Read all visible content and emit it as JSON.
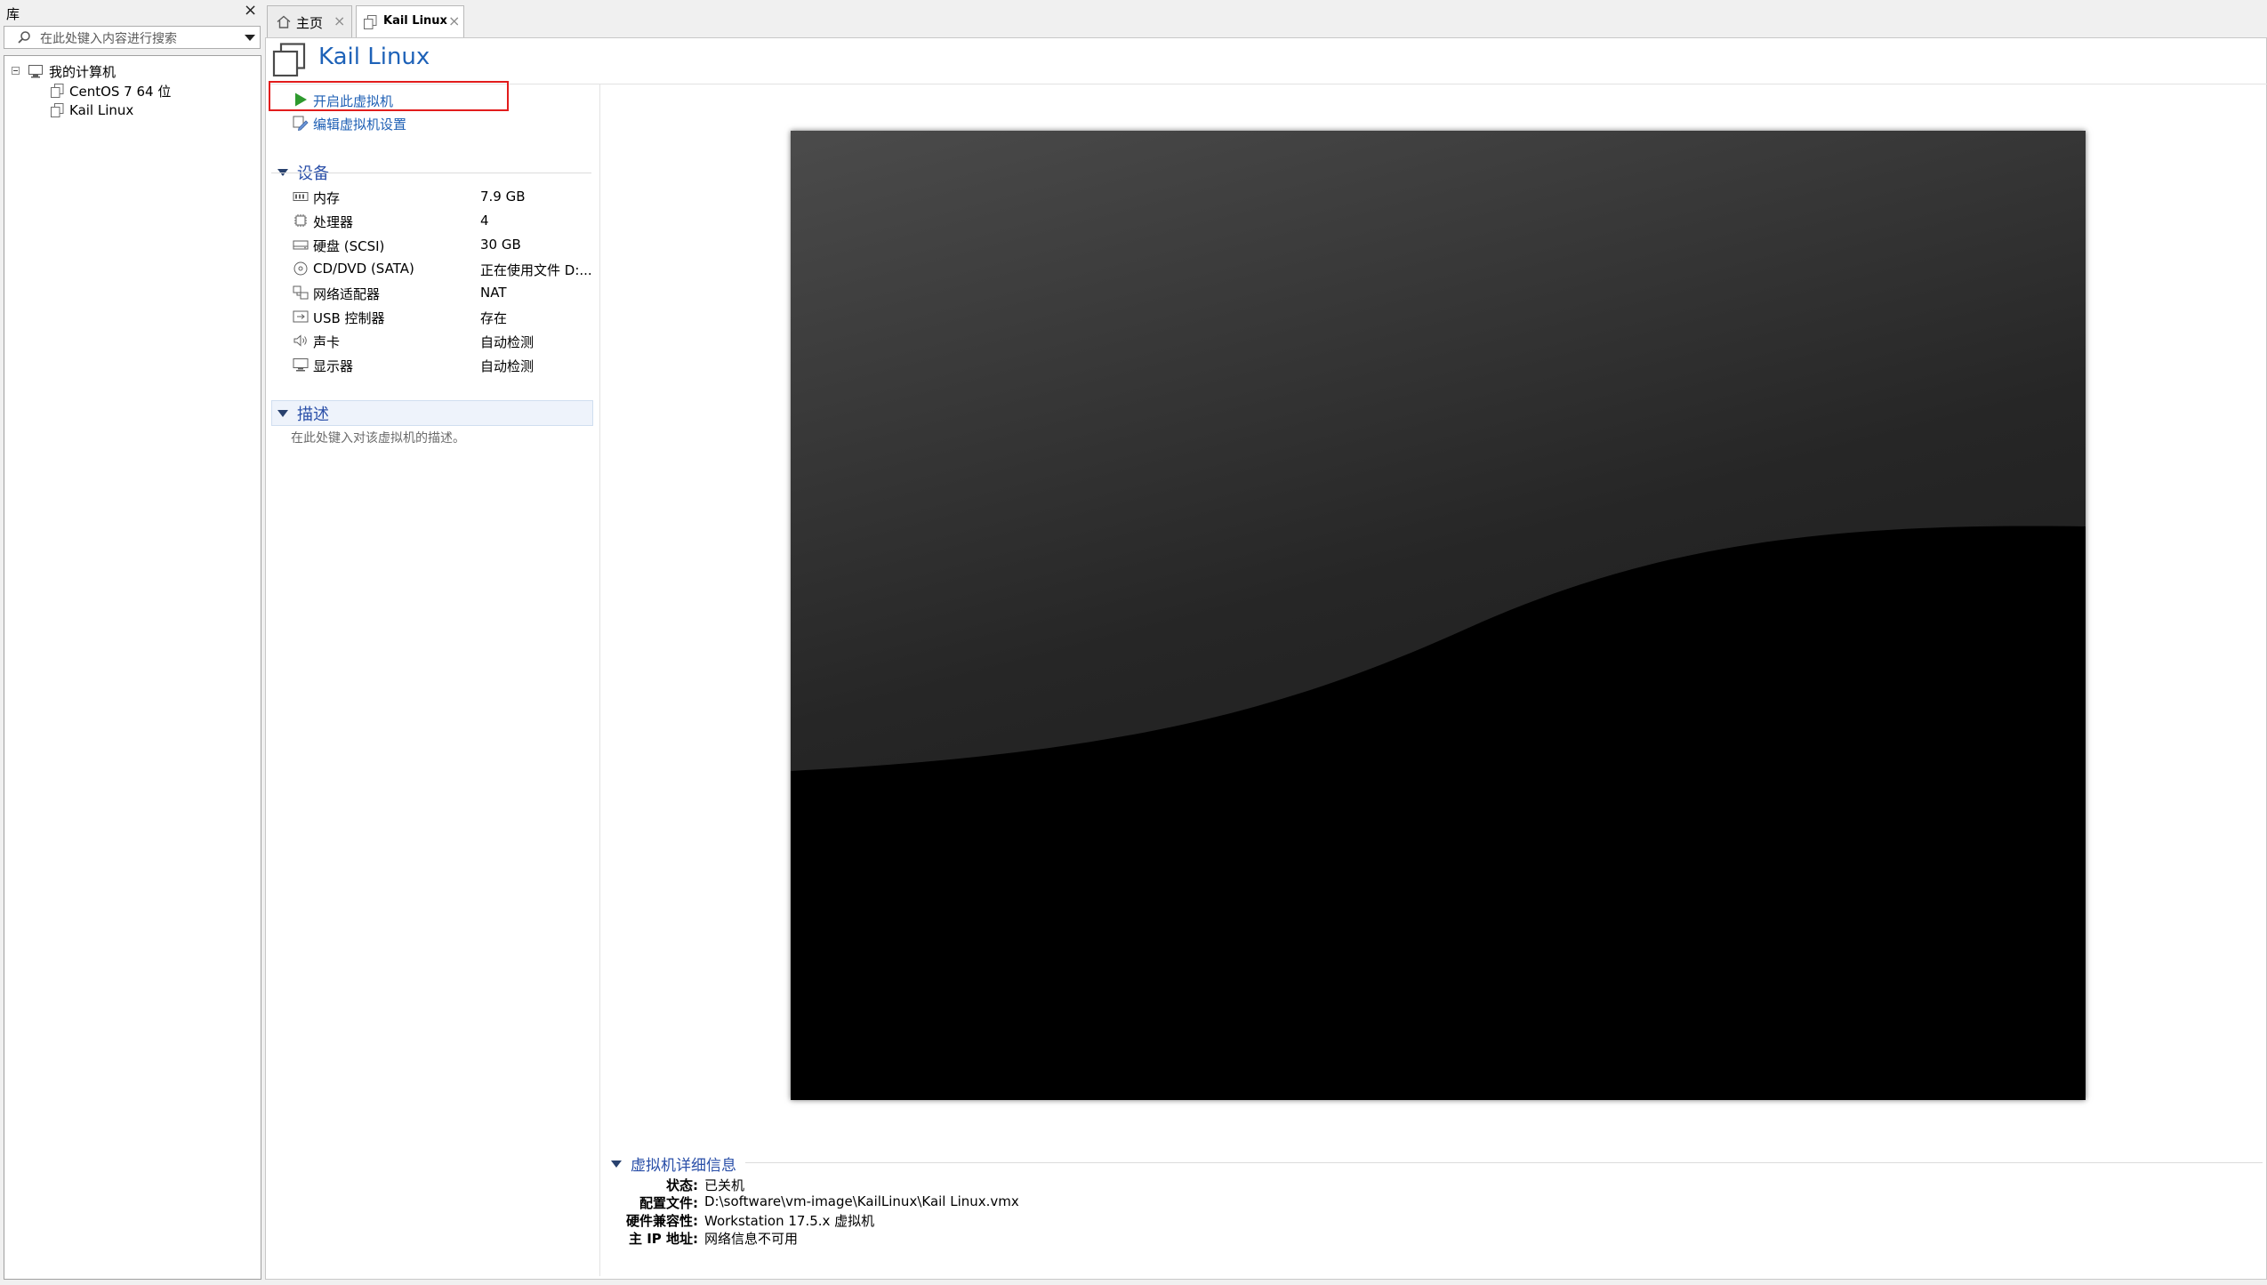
{
  "library": {
    "title": "库",
    "close": "×",
    "search_placeholder": "在此处键入内容进行搜索",
    "tree": {
      "root": "我的计算机",
      "items": [
        "CentOS 7 64 位",
        "Kail Linux"
      ]
    }
  },
  "tabs": [
    {
      "label": "主页",
      "close": "×"
    },
    {
      "label": "Kail Linux",
      "close": "×"
    }
  ],
  "vm": {
    "title": "Kail Linux",
    "actions": {
      "power_on": "开启此虚拟机",
      "edit_settings": "编辑虚拟机设置"
    },
    "devices": {
      "heading": "设备",
      "rows": [
        {
          "icon": "memory-icon",
          "name": "内存",
          "value": "7.9 GB"
        },
        {
          "icon": "cpu-icon",
          "name": "处理器",
          "value": "4"
        },
        {
          "icon": "harddisk-icon",
          "name": "硬盘 (SCSI)",
          "value": "30 GB"
        },
        {
          "icon": "cd-dvd-icon",
          "name": "CD/DVD (SATA)",
          "value": "正在使用文件 D:..."
        },
        {
          "icon": "network-adapter-icon",
          "name": "网络适配器",
          "value": "NAT"
        },
        {
          "icon": "usb-icon",
          "name": "USB 控制器",
          "value": "存在"
        },
        {
          "icon": "sound-icon",
          "name": "声卡",
          "value": "自动检测"
        },
        {
          "icon": "display-icon",
          "name": "显示器",
          "value": "自动检测"
        }
      ]
    },
    "description": {
      "heading": "描述",
      "placeholder": "在此处键入对该虚拟机的描述。"
    },
    "details": {
      "heading": "虚拟机详细信息",
      "rows": [
        {
          "key": "状态:",
          "value": "已关机"
        },
        {
          "key": "配置文件:",
          "value": "D:\\software\\vm-image\\KailLinux\\Kail Linux.vmx"
        },
        {
          "key": "硬件兼容性:",
          "value": "Workstation 17.5.x 虚拟机"
        },
        {
          "key": "主 IP 地址:",
          "value": "网络信息不可用"
        }
      ]
    }
  },
  "colors": {
    "accent_link": "#1e5fb4",
    "section_heading": "#2a4fa8",
    "highlight_box": "#e21c1c",
    "power_play": "#2e9a2e"
  }
}
